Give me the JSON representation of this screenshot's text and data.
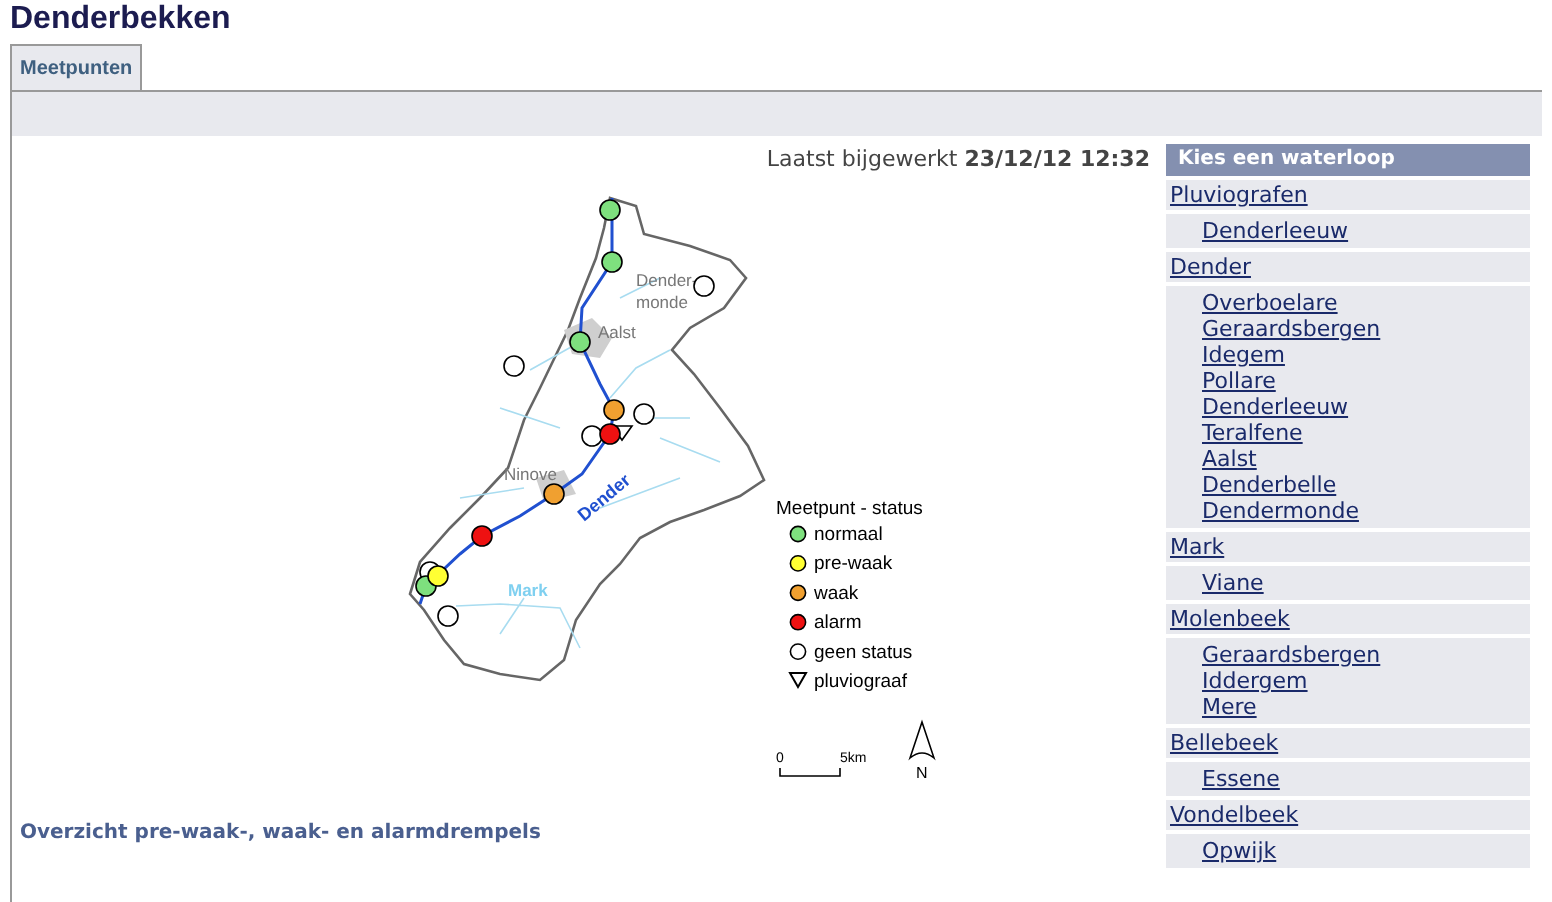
{
  "title": "Denderbekken",
  "tabs": [
    {
      "label": "Meetpunten",
      "selected": true
    }
  ],
  "last_updated": {
    "label": "Laatst bijgewerkt",
    "value": "23/12/12 12:32"
  },
  "map": {
    "labels": [
      {
        "kind": "town",
        "text": "Dender-"
      },
      {
        "kind": "town",
        "text": "monde"
      },
      {
        "kind": "town",
        "text": "Aalst"
      },
      {
        "kind": "town",
        "text": "Ninove"
      },
      {
        "kind": "river",
        "text": "Dender"
      },
      {
        "kind": "stream",
        "text": "Mark"
      }
    ],
    "points": [
      {
        "color": "#7ee07e"
      },
      {
        "color": "#7ee07e"
      },
      {
        "color": "#ffffff"
      },
      {
        "color": "#7ee07e"
      },
      {
        "color": "#ffffff"
      },
      {
        "color": "#f0a030"
      },
      {
        "color": "#ffffff"
      },
      {
        "color": "#ffffff"
      },
      {
        "color": "#ee1111"
      },
      {
        "color": "#f0a030"
      },
      {
        "color": "#ee1111"
      },
      {
        "color": "#ffffff"
      },
      {
        "color": "#7ee07e"
      },
      {
        "color": "#ffff33"
      },
      {
        "color": "#ffffff"
      }
    ],
    "legend": {
      "title": "Meetpunt - status",
      "items": [
        {
          "kind": "dot",
          "label": "normaal",
          "color": "#7ee07e"
        },
        {
          "kind": "dot",
          "label": "pre-waak",
          "color": "#ffff33"
        },
        {
          "kind": "dot",
          "label": "waak",
          "color": "#f0a030"
        },
        {
          "kind": "dot",
          "label": "alarm",
          "color": "#ee1111"
        },
        {
          "kind": "dot",
          "label": "geen status",
          "color": "#ffffff"
        },
        {
          "kind": "triangle",
          "label": "pluviograaf"
        }
      ]
    },
    "scale": {
      "zero": "0",
      "distance": "5km"
    },
    "north": "N"
  },
  "footer_link": "Overzicht pre-waak-, waak- en alarmdrempels",
  "sidebar": {
    "header": "Kies een waterloop",
    "groups": [
      {
        "label": "Pluviografen",
        "children": [
          {
            "label": "Denderleeuw"
          }
        ]
      },
      {
        "label": "Dender",
        "children": [
          {
            "label": "Overboelare"
          },
          {
            "label": "Geraardsbergen"
          },
          {
            "label": "Idegem"
          },
          {
            "label": "Pollare"
          },
          {
            "label": "Denderleeuw"
          },
          {
            "label": "Teralfene"
          },
          {
            "label": "Aalst"
          },
          {
            "label": "Denderbelle"
          },
          {
            "label": "Dendermonde"
          }
        ]
      },
      {
        "label": "Mark",
        "children": [
          {
            "label": "Viane"
          }
        ]
      },
      {
        "label": "Molenbeek",
        "children": [
          {
            "label": "Geraardsbergen"
          },
          {
            "label": "Iddergem"
          },
          {
            "label": "Mere"
          }
        ]
      },
      {
        "label": "Bellebeek",
        "children": [
          {
            "label": "Essene"
          }
        ]
      },
      {
        "label": "Vondelbeek",
        "children": [
          {
            "label": "Opwijk"
          }
        ]
      }
    ]
  }
}
